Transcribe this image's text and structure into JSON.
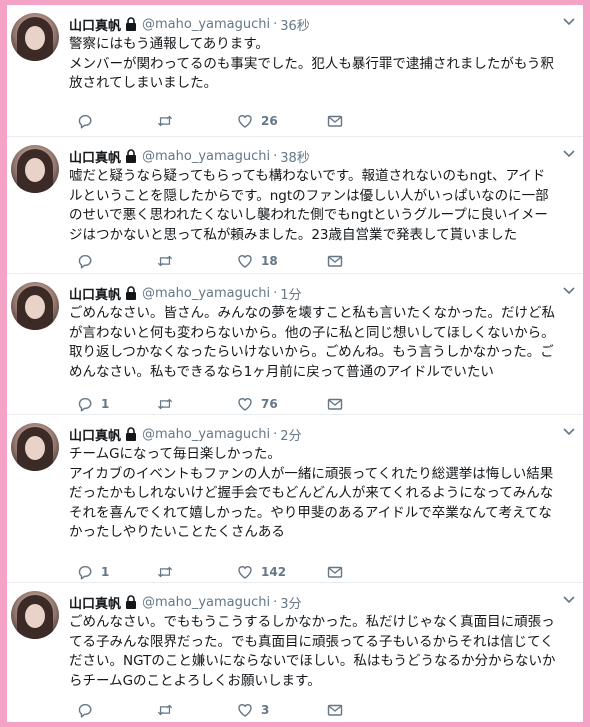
{
  "tweets": [
    {
      "name": "山口真帆",
      "handle": "@maho_yamaguchi",
      "dot": "·",
      "time": "36秒",
      "lines": [
        "警察にはもう通報してあります。",
        "メンバーが関わってるのも事実でした。犯人も暴行罪で逮捕されましたがもう釈",
        "放されてしまいました。"
      ],
      "replies": "",
      "retweets": "",
      "likes": "26"
    },
    {
      "name": "山口真帆",
      "handle": "@maho_yamaguchi",
      "dot": "·",
      "time": "38秒",
      "lines": [
        "嘘だと疑うなら疑ってもらっても構わないです。報道されないのもngt、アイド",
        "ルということを隠したからです。ngtのファンは優しい人がいっぱいなのに一部",
        "のせいで悪く思われたくないし襲われた側でもngtというグループに良いイメー",
        "ジはつかないと思って私が頼みました。23歳自営業で発表して貰いました"
      ],
      "replies": "",
      "retweets": "",
      "likes": "18"
    },
    {
      "name": "山口真帆",
      "handle": "@maho_yamaguchi",
      "dot": "·",
      "time": "1分",
      "lines": [
        "ごめんなさい。皆さん。みんなの夢を壊すこと私も言いたくなかった。だけど私",
        "が言わないと何も変わらないから。他の子に私と同じ想いしてほしくないから。",
        "取り返しつかなくなったらいけないから。ごめんね。もう言うしかなかった。ご",
        "めんなさい。私もできるなら1ヶ月前に戻って普通のアイドルでいたい"
      ],
      "replies": "1",
      "retweets": "",
      "likes": "76"
    },
    {
      "name": "山口真帆",
      "handle": "@maho_yamaguchi",
      "dot": "·",
      "time": "2分",
      "lines": [
        "チームGになって毎日楽しかった。",
        "アイカブのイベントもファンの人が一緒に頑張ってくれたり総選挙は悔しい結果",
        "だったかもしれないけど握手会でもどんどん人が来てくれるようになってみんな",
        "それを喜んでくれて嬉しかった。やり甲斐のあるアイドルで卒業なんて考えてな",
        "かったしやりたいことたくさんある"
      ],
      "replies": "1",
      "retweets": "",
      "likes": "142"
    },
    {
      "name": "山口真帆",
      "handle": "@maho_yamaguchi",
      "dot": "·",
      "time": "3分",
      "lines": [
        "ごめんなさい。でももうこうするしかなかった。私だけじゃなく真面目に頑張っ",
        "てる子みんな限界だった。でも真面目に頑張ってる子もいるからそれは信じてく",
        "ださい。NGTのこと嫌いにならないでほしい。私はもうどうなるか分からないか",
        "らチームGのことよろしくお願いします。"
      ],
      "replies": "",
      "retweets": "",
      "likes": "3"
    }
  ],
  "icons": {
    "reply": "reply-icon",
    "retweet": "retweet-icon",
    "like": "heart-icon",
    "dm": "envelope-icon",
    "lock": "lock-icon",
    "caret": "chevron-down-icon"
  },
  "colors": {
    "frame": "#f4a3c6",
    "muted": "#657786",
    "text": "#14171a"
  }
}
